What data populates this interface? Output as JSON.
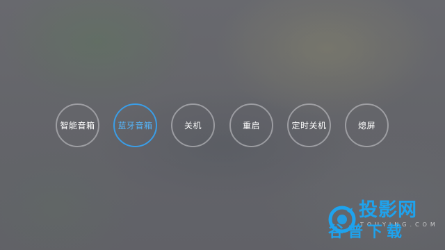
{
  "power_menu": {
    "items": [
      {
        "label": "智能音箱",
        "active": false
      },
      {
        "label": "蓝牙音箱",
        "active": true
      },
      {
        "label": "关机",
        "active": false
      },
      {
        "label": "重启",
        "active": false
      },
      {
        "label": "定时关机",
        "active": false
      },
      {
        "label": "熄屏",
        "active": false
      }
    ],
    "colors": {
      "ring": "#cdcdd2",
      "active_ring": "#3a9ee8",
      "active_text": "#56b3f6",
      "text": "#ffffff"
    }
  },
  "watermark": {
    "title": "投影网",
    "url": "TOUYING.COM",
    "subtitle": "谷普下载",
    "color": "#1ea3ee"
  }
}
